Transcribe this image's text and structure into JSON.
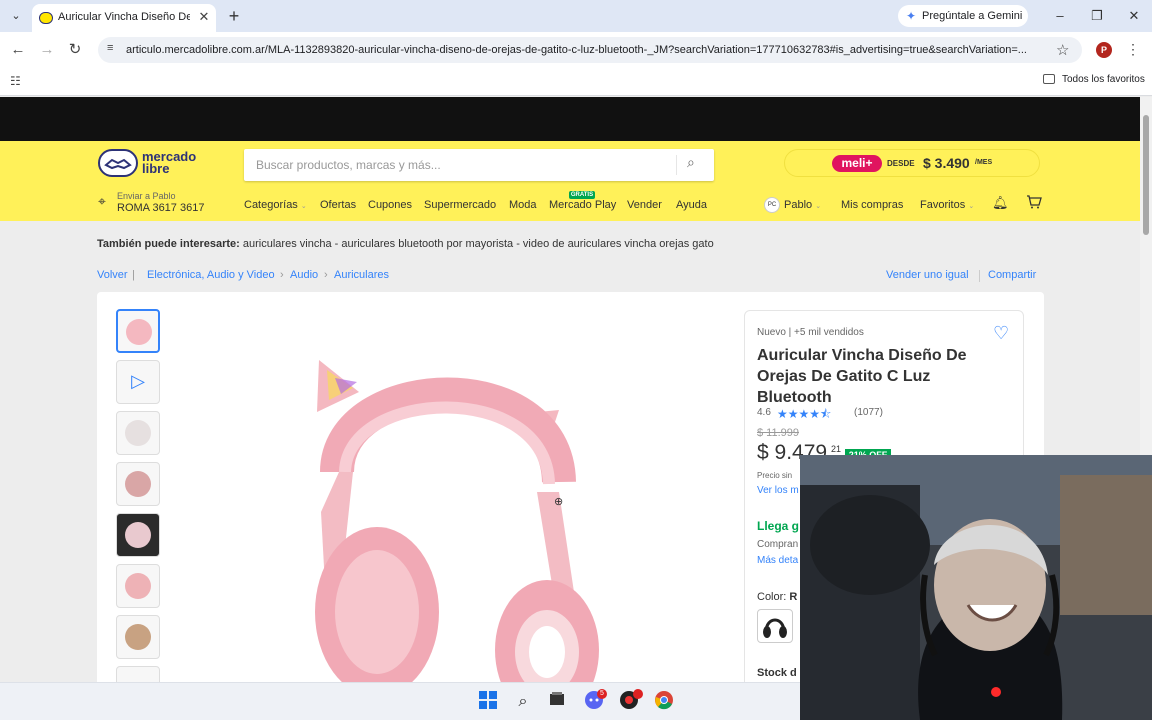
{
  "browser": {
    "tab_title": "Auricular Vincha Diseño De Ore",
    "gemini_label": "Pregúntale a Gemini",
    "url": "articulo.mercadolibre.com.ar/MLA-1132893820-auricular-vincha-diseno-de-orejas-de-gatito-c-luz-bluetooth-_JM?searchVariation=177710632783#is_advertising=true&searchVariation=...",
    "profile_initial": "P",
    "bookmarks_label": "Todos los favoritos"
  },
  "header": {
    "logo_text": "mercado libre",
    "search_placeholder": "Buscar productos, marcas y más...",
    "meli_label": "meli+",
    "meli_desde": "DESDE",
    "meli_price": "$ 3.490",
    "meli_mes": "/MES",
    "location_line1": "Enviar a Pablo",
    "location_line2": "ROMA 3617 3617",
    "nav": [
      "Categorías",
      "Ofertas",
      "Cupones",
      "Supermercado",
      "Moda",
      "Mercado Play",
      "Vender",
      "Ayuda"
    ],
    "gratis_badge": "GRATIS",
    "user_initials": "PC",
    "user_name": "Pablo",
    "my_purchases": "Mis compras",
    "favorites": "Favoritos"
  },
  "interest": {
    "label": "También puede interesarte:",
    "text": "auriculares vincha - auriculares bluetooth por mayorista - video de auriculares vincha orejas gato"
  },
  "breadcrumb": {
    "back": "Volver",
    "items": [
      "Electrónica, Audio y Video",
      "Audio",
      "Auriculares"
    ],
    "sell_same": "Vender uno igual",
    "share": "Compartir"
  },
  "product": {
    "condition": "Nuevo  |  +5 mil vendidos",
    "title": "Auricular Vincha Diseño De Orejas De Gatito C Luz Bluetooth",
    "rating": "4.6",
    "rating_stars": 4.6,
    "rating_count": "(1077)",
    "old_price": "$ 11.999",
    "price": "$ 9.479",
    "price_cents": "21",
    "discount": "21% OFF",
    "price_note": "Precio sin",
    "more_payments": "Ver los m",
    "arrives": "Llega g",
    "compare": "Compran",
    "more_details": "Más deta",
    "color_label": "Color:",
    "color_value": "R",
    "stock": "Stock d"
  },
  "colors": {
    "brand_yellow": "#fff159",
    "link_blue": "#3483fa",
    "discount_green": "#00a650",
    "product_pink": "#f4b8c0"
  }
}
